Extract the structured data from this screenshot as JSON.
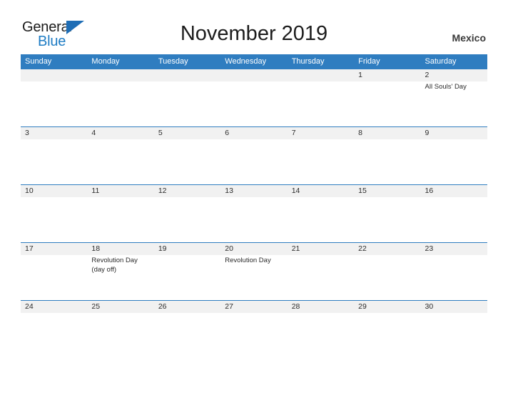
{
  "brand": {
    "name_part1": "General",
    "name_part2": "Blue",
    "color_dark": "#1a1a1a",
    "color_blue": "#1e7cc4",
    "triangle_color": "#1e6db5"
  },
  "header": {
    "title": "November 2019",
    "country": "Mexico",
    "accent_color": "#2f7dc0",
    "band_color": "#f1f1f1"
  },
  "weekdays": [
    "Sunday",
    "Monday",
    "Tuesday",
    "Wednesday",
    "Thursday",
    "Friday",
    "Saturday"
  ],
  "weeks": [
    [
      {
        "day": "",
        "event": ""
      },
      {
        "day": "",
        "event": ""
      },
      {
        "day": "",
        "event": ""
      },
      {
        "day": "",
        "event": ""
      },
      {
        "day": "",
        "event": ""
      },
      {
        "day": "1",
        "event": ""
      },
      {
        "day": "2",
        "event": "All Souls' Day"
      }
    ],
    [
      {
        "day": "3",
        "event": ""
      },
      {
        "day": "4",
        "event": ""
      },
      {
        "day": "5",
        "event": ""
      },
      {
        "day": "6",
        "event": ""
      },
      {
        "day": "7",
        "event": ""
      },
      {
        "day": "8",
        "event": ""
      },
      {
        "day": "9",
        "event": ""
      }
    ],
    [
      {
        "day": "10",
        "event": ""
      },
      {
        "day": "11",
        "event": ""
      },
      {
        "day": "12",
        "event": ""
      },
      {
        "day": "13",
        "event": ""
      },
      {
        "day": "14",
        "event": ""
      },
      {
        "day": "15",
        "event": ""
      },
      {
        "day": "16",
        "event": ""
      }
    ],
    [
      {
        "day": "17",
        "event": ""
      },
      {
        "day": "18",
        "event": "Revolution Day\n(day off)"
      },
      {
        "day": "19",
        "event": ""
      },
      {
        "day": "20",
        "event": "Revolution Day"
      },
      {
        "day": "21",
        "event": ""
      },
      {
        "day": "22",
        "event": ""
      },
      {
        "day": "23",
        "event": ""
      }
    ],
    [
      {
        "day": "24",
        "event": ""
      },
      {
        "day": "25",
        "event": ""
      },
      {
        "day": "26",
        "event": ""
      },
      {
        "day": "27",
        "event": ""
      },
      {
        "day": "28",
        "event": ""
      },
      {
        "day": "29",
        "event": ""
      },
      {
        "day": "30",
        "event": ""
      }
    ]
  ]
}
